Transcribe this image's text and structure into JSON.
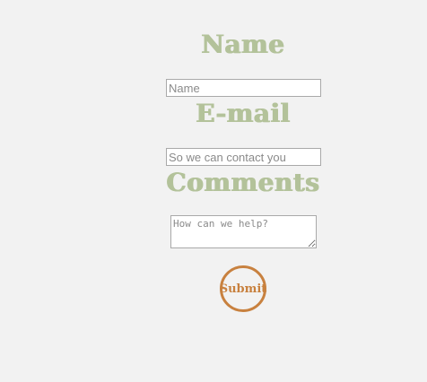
{
  "form": {
    "name": {
      "heading": "Name",
      "placeholder": "Name",
      "value": ""
    },
    "email": {
      "heading": "E-mail",
      "placeholder": "So we can contact you",
      "value": ""
    },
    "comments": {
      "heading": "Comments",
      "placeholder": "How can we help?",
      "value": ""
    },
    "submit_label": "Submit"
  },
  "colors": {
    "background": "#f2f2f2",
    "heading": "#b3c29a",
    "submit_accent": "#c8813f"
  }
}
